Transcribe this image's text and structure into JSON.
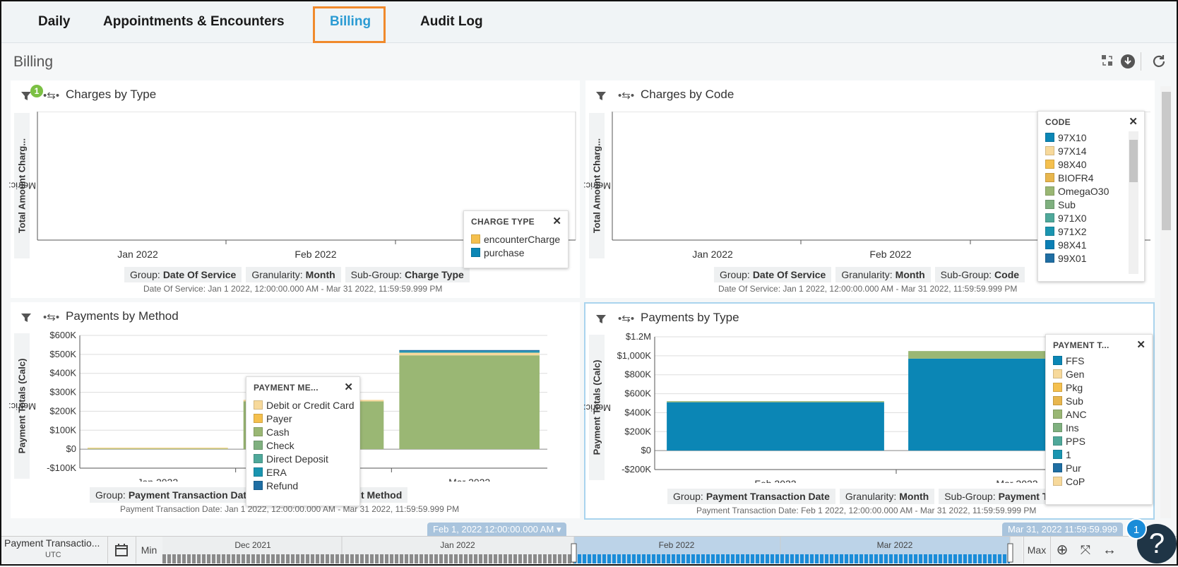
{
  "tabs": [
    {
      "label": "Daily"
    },
    {
      "label": "Appointments & Encounters"
    },
    {
      "label": "Billing"
    },
    {
      "label": "Audit Log"
    }
  ],
  "active_tab": "Billing",
  "page_title": "Billing",
  "colors": {
    "accent": "#2b9bd3",
    "highlight_box": "#f08a2c",
    "bar_blue": "#0b86b5",
    "bar_green": "#9ab774"
  },
  "panels": {
    "charges_by_type": {
      "title": "Charges by Type",
      "filter_badge": "1",
      "metric_prefix": "Metric:",
      "metric": "Total Amount Charg...",
      "chips": [
        {
          "key": "Group:",
          "val": "Date Of Service"
        },
        {
          "key": "Granularity:",
          "val": "Month"
        },
        {
          "key": "Sub-Group:",
          "val": "Charge Type"
        }
      ],
      "range": "Date Of Service: Jan 1 2022, 12:00:00.000 AM - Mar 31 2022, 11:59:59.999 PM",
      "legend": {
        "title": "CHARGE TYPE",
        "items": [
          {
            "label": "encounterCharge",
            "color": "#f5c04e"
          },
          {
            "label": "purchase",
            "color": "#0b86b5"
          }
        ]
      }
    },
    "charges_by_code": {
      "title": "Charges by Code",
      "metric_prefix": "Metric:",
      "metric": "Total Amount Charg...",
      "chips": [
        {
          "key": "Group:",
          "val": "Date Of Service"
        },
        {
          "key": "Granularity:",
          "val": "Month"
        },
        {
          "key": "Sub-Group:",
          "val": "Code"
        }
      ],
      "range": "Date Of Service: Jan 1 2022, 12:00:00.000 AM - Mar 31 2022, 11:59:59.999 PM",
      "legend": {
        "title": "CODE",
        "items": [
          {
            "label": "97X10",
            "color": "#0b86b5"
          },
          {
            "label": "97X14",
            "color": "#f7d99b"
          },
          {
            "label": "98X40",
            "color": "#f5c04e"
          },
          {
            "label": "BIOFR4",
            "color": "#e8b64d"
          },
          {
            "label": "OmegaO30",
            "color": "#9ab774"
          },
          {
            "label": "Sub",
            "color": "#7fb07f"
          },
          {
            "label": "971X0",
            "color": "#4fa89a"
          },
          {
            "label": "971X2",
            "color": "#1a95b0"
          },
          {
            "label": "98X41",
            "color": "#0b7fb5"
          },
          {
            "label": "99X01",
            "color": "#1f6ea3"
          }
        ]
      }
    },
    "payments_by_method": {
      "title": "Payments by Method",
      "metric_prefix": "Metric:",
      "metric": "Payment Totals (Calc)",
      "chips": [
        {
          "key": "Group:",
          "val": "Payment Transaction Date"
        },
        {
          "key": "Sub-Group:",
          "val": "Payment Method"
        }
      ],
      "range": "Payment Transaction Date: Jan 1 2022, 12:00:00.000 AM - Mar 31 2022, 11:59:59.999 PM",
      "legend": {
        "title": "PAYMENT ME...",
        "items": [
          {
            "label": "Debit or Credit Card",
            "color": "#f7d99b"
          },
          {
            "label": "Payer",
            "color": "#f5c04e"
          },
          {
            "label": "Cash",
            "color": "#9ab774"
          },
          {
            "label": "Check",
            "color": "#7fb07f"
          },
          {
            "label": "Direct Deposit",
            "color": "#4fa89a"
          },
          {
            "label": "ERA",
            "color": "#1a95b0"
          },
          {
            "label": "Refund",
            "color": "#1f6ea3"
          }
        ]
      }
    },
    "payments_by_type": {
      "title": "Payments by Type",
      "metric_prefix": "Metric:",
      "metric": "Payment Totals (Calc)",
      "chips": [
        {
          "key": "Group:",
          "val": "Payment Transaction Date"
        },
        {
          "key": "Granularity:",
          "val": "Month"
        },
        {
          "key": "Sub-Group:",
          "val": "Payment T"
        }
      ],
      "range": "Payment Transaction Date: Feb 1 2022, 12:00:00.000 AM - Mar 31 2022, 11:59:59.999 PM",
      "legend": {
        "title": "PAYMENT T...",
        "items": [
          {
            "label": "FFS",
            "color": "#0b86b5"
          },
          {
            "label": "Gen",
            "color": "#f7d99b"
          },
          {
            "label": "Pkg",
            "color": "#f5c04e"
          },
          {
            "label": "Sub",
            "color": "#e8b64d"
          },
          {
            "label": "ANC",
            "color": "#9ab774"
          },
          {
            "label": "Ins",
            "color": "#7fb07f"
          },
          {
            "label": "PPS",
            "color": "#4fa89a"
          },
          {
            "label": "1",
            "color": "#1a95b0"
          },
          {
            "label": "Pur",
            "color": "#1f6ea3"
          },
          {
            "label": "CoP",
            "color": "#f7d99b"
          }
        ]
      }
    }
  },
  "chart_data": [
    {
      "type": "bar",
      "title": "Charges by Type",
      "categories": [
        "Jan 2022",
        "Feb 2022",
        "Mar 2022"
      ],
      "series": [],
      "ylabel": "Total Amount Charg..."
    },
    {
      "type": "bar",
      "title": "Charges by Code",
      "categories": [
        "Jan 2022",
        "Feb 2022",
        "Mar 2022"
      ],
      "series": [],
      "ylabel": "Total Amount Charg..."
    },
    {
      "type": "bar",
      "title": "Payments by Method",
      "stacked": true,
      "categories": [
        "Jan 2022",
        "Feb 2022",
        "Mar 2022"
      ],
      "yticks": [
        "$600K",
        "$500K",
        "$400K",
        "$300K",
        "$200K",
        "$100K",
        "$0",
        "-$100K"
      ],
      "ylim": [
        -100000,
        600000
      ],
      "series": [
        {
          "name": "Cash",
          "values": [
            3000,
            252000,
            495000
          ]
        },
        {
          "name": "Debit or Credit Card",
          "values": [
            1000,
            8000,
            14000
          ]
        },
        {
          "name": "ERA",
          "values": [
            0,
            0,
            8000
          ]
        },
        {
          "name": "Refund",
          "values": [
            0,
            0,
            3000
          ]
        }
      ],
      "ylabel": "Payment Totals (Calc)"
    },
    {
      "type": "bar",
      "title": "Payments by Type",
      "stacked": true,
      "categories": [
        "Feb 2022",
        "Mar 2022"
      ],
      "yticks": [
        "$1.2M",
        "$1,000K",
        "$800K",
        "$600K",
        "$400K",
        "$200K",
        "$0",
        "-$200K"
      ],
      "ylim": [
        -200000,
        1200000
      ],
      "series": [
        {
          "name": "FFS",
          "values": [
            510000,
            970000
          ]
        },
        {
          "name": "ANC",
          "values": [
            5000,
            80000
          ]
        }
      ],
      "ylabel": "Payment Totals (Calc)"
    }
  ],
  "timeline": {
    "label": "Payment Transactio...",
    "tz": "UTC",
    "min": "Min",
    "max": "Max",
    "months": [
      "Dec 2021",
      "Jan 2022",
      "Feb 2022",
      "Mar 2022"
    ],
    "start_flag": "Feb 1, 2022 12:00:00.000 AM",
    "end_flag": "Mar 31, 2022 11:59:59.999"
  },
  "help": {
    "label": "?",
    "badge": "1"
  }
}
